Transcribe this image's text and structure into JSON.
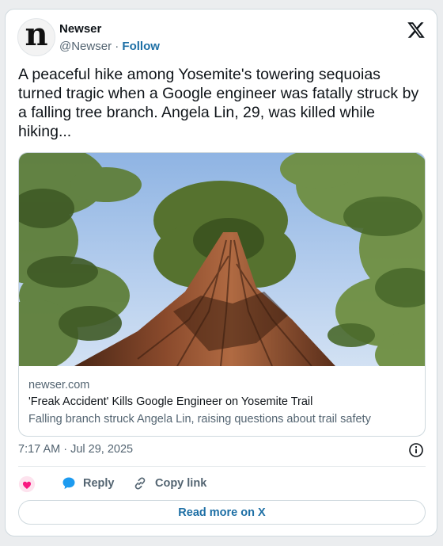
{
  "author": {
    "name": "Newser",
    "handle": "@Newser",
    "separator": "·",
    "follow_label": "Follow",
    "avatar_letter": "n"
  },
  "tweet": {
    "text": "A peaceful hike among Yosemite's towering sequoias turned tragic when a Google engineer was fatally struck by a falling tree branch. Angela Lin, 29, was killed while hiking..."
  },
  "link_card": {
    "domain": "newser.com",
    "title": "'Freak Accident' Kills Google Engineer on Yosemite Trail",
    "description": "Falling branch struck Angela Lin, raising questions about trail safety"
  },
  "meta": {
    "timestamp": "7:17 AM · Jul 29, 2025"
  },
  "actions": {
    "reply_label": "Reply",
    "copy_link_label": "Copy link",
    "read_more_label": "Read more on X"
  },
  "icons": {
    "brand": "x-logo-icon",
    "info": "info-icon",
    "like": "heart-icon",
    "reply": "speech-bubble-icon",
    "copy": "link-icon"
  },
  "colors": {
    "accent": "#1d6fa5",
    "heart": "#f91880",
    "reply": "#1d9bf0",
    "muted": "#536471"
  }
}
